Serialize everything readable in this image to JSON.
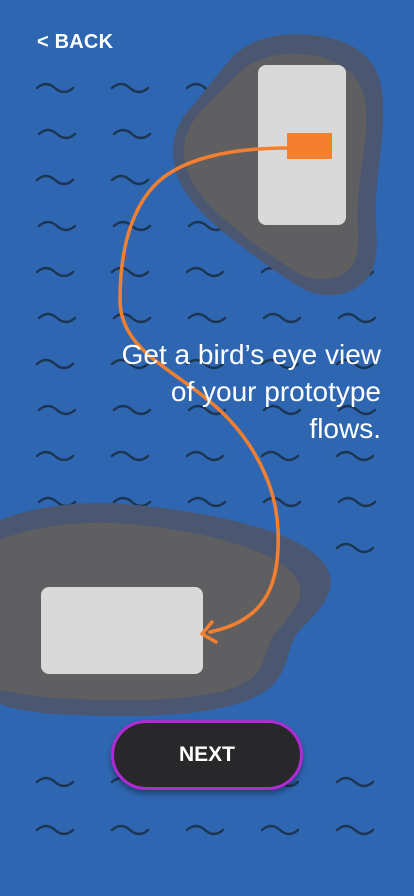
{
  "nav": {
    "back_label": "< BACK"
  },
  "onboarding": {
    "headline": "Get a bird’s eye view of your prototype flows."
  },
  "actions": {
    "next_label": "NEXT"
  },
  "colors": {
    "background": "#2f66b2",
    "island_outer": "#4b5670",
    "island_inner": "#5f5f61",
    "screen_card": "#d9d9d9",
    "hotspot": "#f4802f",
    "flow_arrow": "#f4802f",
    "button_fill": "#28282a",
    "button_border": "#b02bd4"
  }
}
